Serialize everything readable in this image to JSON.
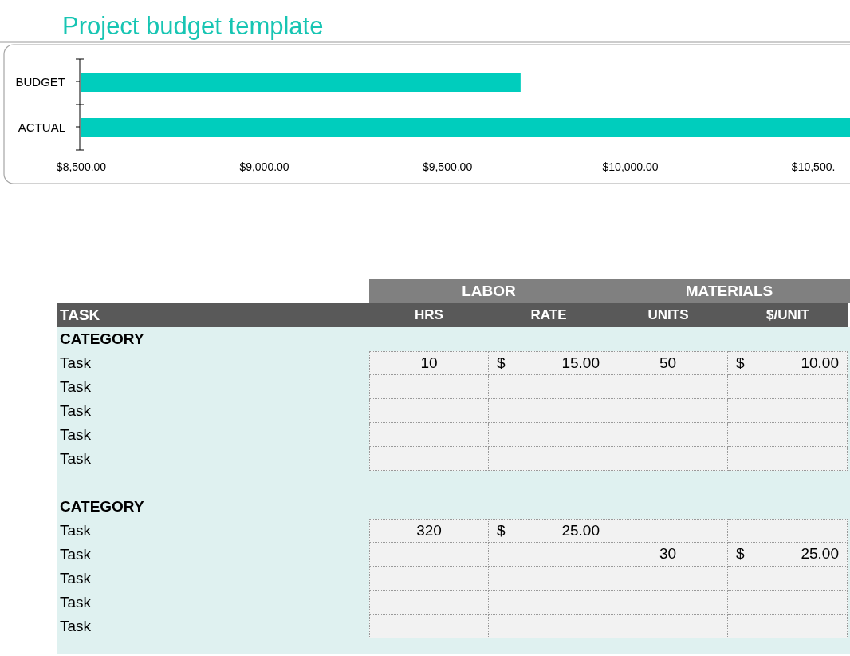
{
  "title": "Project budget template",
  "chart": {
    "chart_data": {
      "type": "bar",
      "orientation": "horizontal",
      "categories": [
        "BUDGET",
        "ACTUAL"
      ],
      "series": [
        {
          "color": "#00cdbd",
          "values": [
            9700,
            10600
          ]
        }
      ],
      "xlim": [
        8500,
        10600
      ],
      "xticks": [
        {
          "value": 8500,
          "label": "$8,500.00"
        },
        {
          "value": 9000,
          "label": "$9,000.00"
        },
        {
          "value": 9500,
          "label": "$9,500.00"
        },
        {
          "value": 10000,
          "label": "$10,000.00"
        },
        {
          "value": 10500,
          "label": "$10,500."
        }
      ]
    }
  },
  "table": {
    "groups": [
      {
        "label": "LABOR"
      },
      {
        "label": "MATERIALS"
      }
    ],
    "columns": [
      "TASK",
      "HRS",
      "RATE",
      "UNITS",
      "$/UNIT"
    ],
    "sections": [
      {
        "category": "CATEGORY",
        "rows": [
          {
            "task": "Task",
            "hrs": "10",
            "rate_currency": "$",
            "rate": "15.00",
            "units": "50",
            "unit_currency": "$",
            "unit_price": "10.00"
          },
          {
            "task": "Task"
          },
          {
            "task": "Task"
          },
          {
            "task": "Task"
          },
          {
            "task": "Task"
          }
        ]
      },
      {
        "category": "CATEGORY",
        "rows": [
          {
            "task": "Task",
            "hrs": "320",
            "rate_currency": "$",
            "rate": "25.00"
          },
          {
            "task": "Task",
            "units": "30",
            "unit_currency": "$",
            "unit_price": "25.00"
          },
          {
            "task": "Task"
          },
          {
            "task": "Task"
          },
          {
            "task": "Task"
          }
        ]
      }
    ]
  }
}
